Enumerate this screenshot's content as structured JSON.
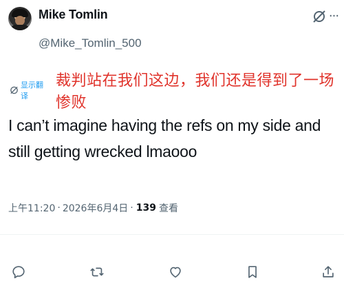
{
  "user": {
    "display_name": "Mike Tomlin",
    "handle": "@Mike_Tomlin_500"
  },
  "translation": {
    "label": "显示翻译",
    "text": "裁判站在我们这边，我们还是得到了一场惨败"
  },
  "tweet": {
    "text": "I can’t imagine having the refs on my side and still getting wrecked lmaooo"
  },
  "meta": {
    "time": "上午11:20",
    "separator1": "·",
    "date": "2026年6月4日",
    "separator2": "·",
    "views_count": "139",
    "views_label": "查看"
  },
  "icons": {
    "grok": "grok-icon",
    "more": "more-icon",
    "translate": "translate-icon",
    "reply": "reply-icon",
    "retweet": "retweet-icon",
    "like": "like-icon",
    "bookmark": "bookmark-icon",
    "share": "share-icon"
  },
  "colors": {
    "translated_text": "#e0332b",
    "translate_label": "#1d9bf0",
    "secondary": "#536471"
  }
}
